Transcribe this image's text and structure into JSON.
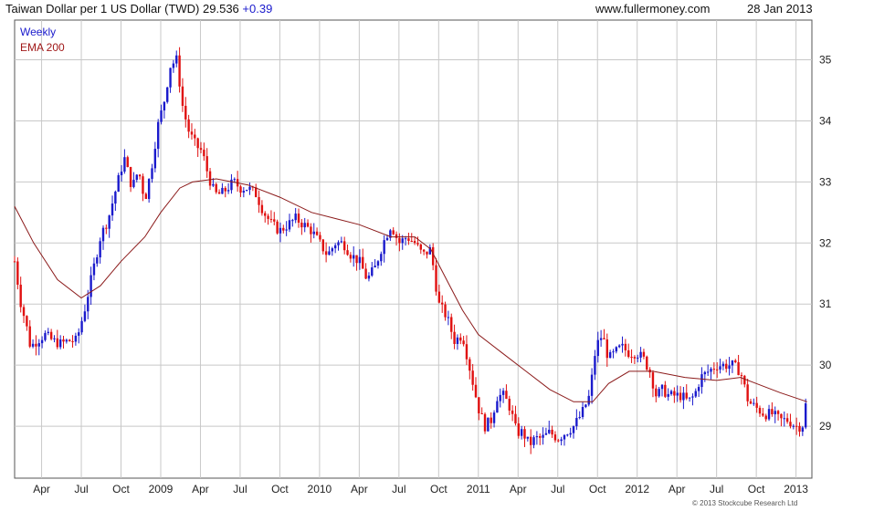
{
  "header": {
    "title": "Taiwan Dollar per 1 US Dollar (TWD)",
    "last": "29.536",
    "change": "+0.39",
    "site": "www.fullermoney.com",
    "date": "28 Jan 2013"
  },
  "copyright": "© 2013 Stockcube Research Ltd",
  "colors": {
    "up": "#1a1acc",
    "down": "#e01010",
    "ema": "#8b1a1a",
    "grid": "#c8c8c8",
    "frame": "#555555"
  },
  "chart_data": {
    "type": "candlestick",
    "legend": [
      "Weekly",
      "EMA 200"
    ],
    "y_ticks": [
      "29",
      "30",
      "31",
      "32",
      "33",
      "34",
      "35"
    ],
    "ylim": [
      28.15,
      35.65
    ],
    "x_ticks": [
      "Apr",
      "Jul",
      "Oct",
      "2009",
      "Apr",
      "Jul",
      "Oct",
      "2010",
      "Apr",
      "Jul",
      "Oct",
      "2011",
      "Apr",
      "Jul",
      "Oct",
      "2012",
      "Apr",
      "Jul",
      "Oct",
      "2013"
    ],
    "x_tick_months": [
      2008.25,
      2008.5,
      2008.75,
      2009.0,
      2009.25,
      2009.5,
      2009.75,
      2010.0,
      2010.25,
      2010.5,
      2010.75,
      2011.0,
      2011.25,
      2011.5,
      2011.75,
      2012.0,
      2012.25,
      2012.5,
      2012.75,
      2013.0
    ],
    "x_range": [
      2008.08,
      2013.1
    ],
    "weekly_close_path": [
      [
        2008.08,
        31.7
      ],
      [
        2008.12,
        31.0
      ],
      [
        2008.15,
        30.7
      ],
      [
        2008.18,
        30.3
      ],
      [
        2008.22,
        30.4
      ],
      [
        2008.27,
        30.5
      ],
      [
        2008.32,
        30.4
      ],
      [
        2008.37,
        30.35
      ],
      [
        2008.42,
        30.4
      ],
      [
        2008.47,
        30.4
      ],
      [
        2008.52,
        30.9
      ],
      [
        2008.57,
        31.5
      ],
      [
        2008.62,
        32.1
      ],
      [
        2008.67,
        32.4
      ],
      [
        2008.72,
        32.9
      ],
      [
        2008.77,
        33.4
      ],
      [
        2008.82,
        32.9
      ],
      [
        2008.86,
        33.2
      ],
      [
        2008.9,
        32.7
      ],
      [
        2008.94,
        33.2
      ],
      [
        2008.98,
        33.9
      ],
      [
        2009.02,
        34.3
      ],
      [
        2009.06,
        34.9
      ],
      [
        2009.1,
        35.0
      ],
      [
        2009.14,
        34.2
      ],
      [
        2009.18,
        33.8
      ],
      [
        2009.22,
        33.6
      ],
      [
        2009.26,
        33.5
      ],
      [
        2009.3,
        33.1
      ],
      [
        2009.34,
        32.8
      ],
      [
        2009.38,
        32.8
      ],
      [
        2009.42,
        32.9
      ],
      [
        2009.46,
        33.0
      ],
      [
        2009.5,
        32.9
      ],
      [
        2009.55,
        32.9
      ],
      [
        2009.6,
        32.8
      ],
      [
        2009.65,
        32.5
      ],
      [
        2009.7,
        32.3
      ],
      [
        2009.75,
        32.2
      ],
      [
        2009.8,
        32.3
      ],
      [
        2009.85,
        32.4
      ],
      [
        2009.9,
        32.3
      ],
      [
        2009.95,
        32.2
      ],
      [
        2010.0,
        32.0
      ],
      [
        2010.05,
        31.8
      ],
      [
        2010.1,
        32.0
      ],
      [
        2010.15,
        32.0
      ],
      [
        2010.2,
        31.8
      ],
      [
        2010.25,
        31.7
      ],
      [
        2010.3,
        31.4
      ],
      [
        2010.35,
        31.6
      ],
      [
        2010.4,
        32.0
      ],
      [
        2010.45,
        32.3
      ],
      [
        2010.5,
        32.0
      ],
      [
        2010.55,
        32.1
      ],
      [
        2010.6,
        32.0
      ],
      [
        2010.65,
        31.8
      ],
      [
        2010.7,
        31.9
      ],
      [
        2010.75,
        31.0
      ],
      [
        2010.8,
        30.8
      ],
      [
        2010.85,
        30.4
      ],
      [
        2010.9,
        30.5
      ],
      [
        2010.95,
        29.9
      ],
      [
        2011.0,
        29.3
      ],
      [
        2011.04,
        29.0
      ],
      [
        2011.08,
        29.1
      ],
      [
        2011.12,
        29.5
      ],
      [
        2011.16,
        29.5
      ],
      [
        2011.2,
        29.3
      ],
      [
        2011.24,
        28.9
      ],
      [
        2011.28,
        28.9
      ],
      [
        2011.32,
        28.7
      ],
      [
        2011.36,
        28.8
      ],
      [
        2011.4,
        28.8
      ],
      [
        2011.45,
        28.9
      ],
      [
        2011.5,
        28.8
      ],
      [
        2011.55,
        28.9
      ],
      [
        2011.6,
        29.0
      ],
      [
        2011.65,
        29.2
      ],
      [
        2011.7,
        29.5
      ],
      [
        2011.74,
        30.3
      ],
      [
        2011.78,
        30.5
      ],
      [
        2011.82,
        30.1
      ],
      [
        2011.86,
        30.2
      ],
      [
        2011.9,
        30.3
      ],
      [
        2011.95,
        30.2
      ],
      [
        2012.0,
        30.2
      ],
      [
        2012.04,
        30.1
      ],
      [
        2012.08,
        29.9
      ],
      [
        2012.12,
        29.5
      ],
      [
        2012.16,
        29.6
      ],
      [
        2012.2,
        29.5
      ],
      [
        2012.24,
        29.5
      ],
      [
        2012.28,
        29.5
      ],
      [
        2012.32,
        29.4
      ],
      [
        2012.36,
        29.5
      ],
      [
        2012.4,
        29.8
      ],
      [
        2012.45,
        29.9
      ],
      [
        2012.5,
        30.0
      ],
      [
        2012.55,
        30.0
      ],
      [
        2012.6,
        30.0
      ],
      [
        2012.65,
        29.9
      ],
      [
        2012.7,
        29.4
      ],
      [
        2012.75,
        29.3
      ],
      [
        2012.8,
        29.2
      ],
      [
        2012.85,
        29.2
      ],
      [
        2012.9,
        29.1
      ],
      [
        2012.95,
        29.1
      ],
      [
        2013.0,
        29.0
      ],
      [
        2013.04,
        29.0
      ],
      [
        2013.07,
        29.5
      ]
    ],
    "ema200_path": [
      [
        2008.08,
        32.6
      ],
      [
        2008.2,
        32.0
      ],
      [
        2008.35,
        31.4
      ],
      [
        2008.5,
        31.1
      ],
      [
        2008.62,
        31.3
      ],
      [
        2008.75,
        31.7
      ],
      [
        2008.9,
        32.1
      ],
      [
        2009.0,
        32.5
      ],
      [
        2009.12,
        32.9
      ],
      [
        2009.2,
        33.0
      ],
      [
        2009.35,
        33.05
      ],
      [
        2009.55,
        32.95
      ],
      [
        2009.75,
        32.75
      ],
      [
        2009.95,
        32.5
      ],
      [
        2010.1,
        32.4
      ],
      [
        2010.25,
        32.3
      ],
      [
        2010.45,
        32.1
      ],
      [
        2010.6,
        32.1
      ],
      [
        2010.7,
        31.9
      ],
      [
        2010.8,
        31.4
      ],
      [
        2010.9,
        30.9
      ],
      [
        2011.0,
        30.5
      ],
      [
        2011.15,
        30.2
      ],
      [
        2011.3,
        29.9
      ],
      [
        2011.45,
        29.6
      ],
      [
        2011.6,
        29.4
      ],
      [
        2011.72,
        29.4
      ],
      [
        2011.82,
        29.7
      ],
      [
        2011.95,
        29.9
      ],
      [
        2012.1,
        29.9
      ],
      [
        2012.3,
        29.8
      ],
      [
        2012.5,
        29.75
      ],
      [
        2012.65,
        29.8
      ],
      [
        2012.75,
        29.7
      ],
      [
        2012.9,
        29.55
      ],
      [
        2013.07,
        29.4
      ]
    ]
  }
}
